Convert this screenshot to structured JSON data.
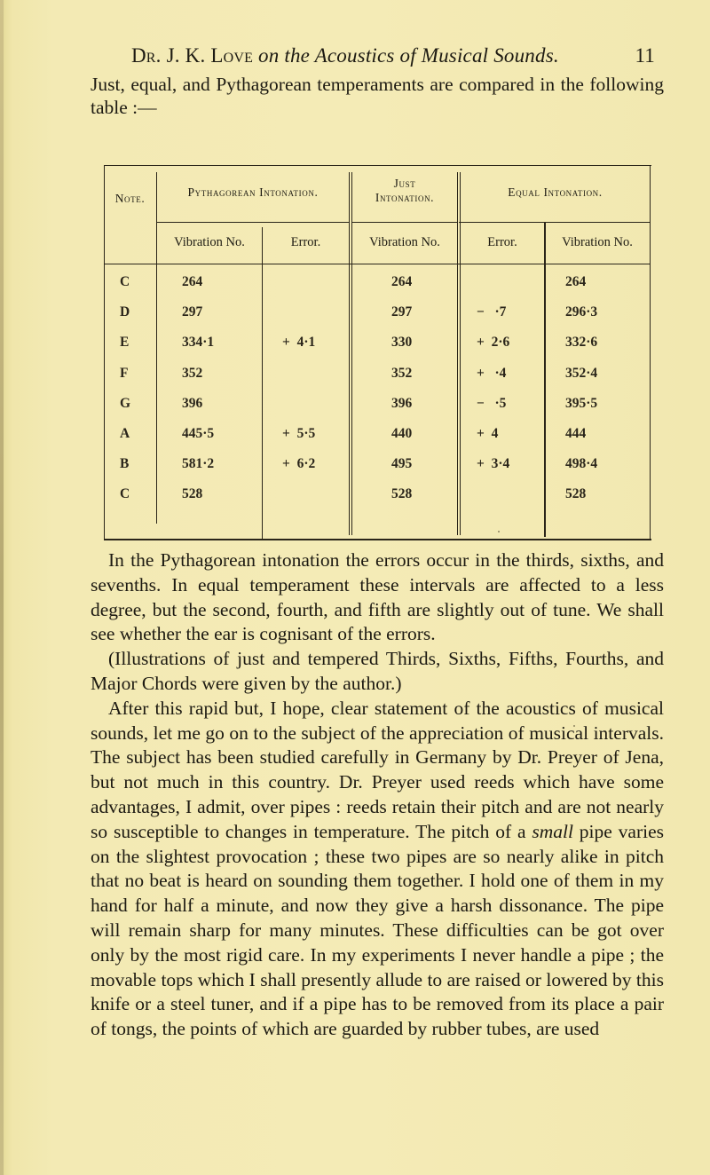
{
  "running_head": {
    "author": "Dr. J. K. Love",
    "title": "on the Acoustics of Musical Sounds.",
    "page_number": "11"
  },
  "intro": "Just, equal, and Pythagorean temperaments are compared in the following table :—",
  "table": {
    "group_headers": {
      "note": "Note.",
      "pythagorean": "Pythagorean Intonation.",
      "just_line1": "Just",
      "just_line2": "Intonation.",
      "equal": "Equal Intonation."
    },
    "sub_headers": {
      "pyth_vibration": "Vibration No.",
      "pyth_error": "Error.",
      "just_vibration": "Vibration No.",
      "equal_error": "Error.",
      "equal_vibration": "Vibration No."
    },
    "rows": [
      {
        "note": "C",
        "pyth_vib": "264",
        "pyth_err": "",
        "just_vib": "264",
        "eq_err": "",
        "eq_vib": "264"
      },
      {
        "note": "D",
        "pyth_vib": "297",
        "pyth_err": "",
        "just_vib": "297",
        "eq_err": "−   ·7",
        "eq_vib": "296·3"
      },
      {
        "note": "E",
        "pyth_vib": "334·1",
        "pyth_err": "+  4·1",
        "just_vib": "330",
        "eq_err": "+  2·6",
        "eq_vib": "332·6"
      },
      {
        "note": "F",
        "pyth_vib": "352",
        "pyth_err": "",
        "just_vib": "352",
        "eq_err": "+   ·4",
        "eq_vib": "352·4"
      },
      {
        "note": "G",
        "pyth_vib": "396",
        "pyth_err": "",
        "just_vib": "396",
        "eq_err": "−   ·5",
        "eq_vib": "395·5"
      },
      {
        "note": "A",
        "pyth_vib": "445·5",
        "pyth_err": "+  5·5",
        "just_vib": "440",
        "eq_err": "+  4",
        "eq_vib": "444"
      },
      {
        "note": "B",
        "pyth_vib": "581·2",
        "pyth_err": "+  6·2",
        "just_vib": "495",
        "eq_err": "+  3·4",
        "eq_vib": "498·4"
      },
      {
        "note": "C",
        "pyth_vib": "528",
        "pyth_err": "",
        "just_vib": "528",
        "eq_err": "",
        "eq_vib": "528"
      }
    ]
  },
  "paragraphs": [
    {
      "text": "In the Pythagorean intonation the errors occur in the thirds, sixths, and sevenths.  In equal temperament these intervals are affected to a less degree, but the second, fourth, and fifth are slightly out of tune.  We shall see whether the ear is cognisant of the errors."
    },
    {
      "text": "(Illustrations of just and tempered Thirds, Sixths, Fifths, Fourths, and Major Chords were given by the author.)"
    },
    {
      "before_italic": "After this rapid but, I hope, clear statement of the acoustics of musical sounds, let me go on to the subject of the appreciation of musical intervals.  The subject has been studied carefully in Germany by Dr. Preyer of Jena, but not much in this country. Dr. Preyer used reeds which have some advantages, I admit, over pipes : reeds retain their pitch and are not nearly so susceptible to changes in temperature.  The pitch of a ",
      "italic": "small",
      "after_italic": " pipe varies on the slightest provocation ; these two pipes are so nearly alike in pitch that no beat is heard on sounding them together.  I hold one of them in my hand for half a minute, and now they give a harsh dissonance.  The pipe will remain sharp for many minutes. These difficulties can be got over only by the most rigid care.  In my experiments I never handle a pipe ; the movable tops which I shall presently allude to are raised or lowered by this knife or a steel tuner, and if a pipe has to be removed from its place a pair of tongs, the points of which are guarded by rubber tubes, are used"
    }
  ]
}
